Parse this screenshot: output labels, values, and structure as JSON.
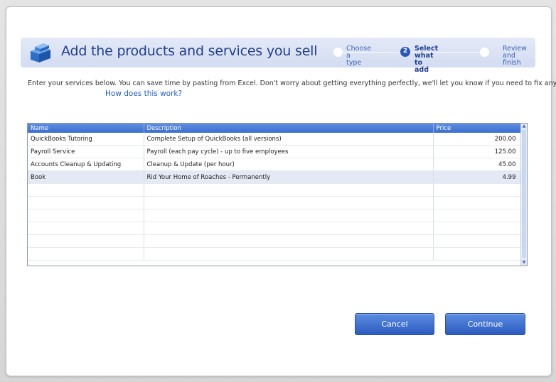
{
  "header": {
    "title": "Add the products and services you sell",
    "icon": "stacked-boxes-icon"
  },
  "steps": [
    {
      "label": "Choose a\ntype",
      "number": "",
      "active": false
    },
    {
      "label": "Select what\nto add",
      "number": "2",
      "active": true
    },
    {
      "label": "Review and\nfinish",
      "number": "",
      "active": false
    }
  ],
  "intro": {
    "text": "Enter your services below.  You can save time by pasting from Excel. Don't worry about getting everything perfectly, we'll let you know if you need to fix anything.",
    "help_link": "How does this work?"
  },
  "grid": {
    "columns": [
      "Name",
      "Description",
      "Price"
    ],
    "rows": [
      {
        "name": "QuickBooks Tutoring",
        "description": "Complete Setup of QuickBooks (all versions)",
        "price": "200.00"
      },
      {
        "name": "Payroll Service",
        "description": "Payroll  (each pay cycle) - up to five employees",
        "price": "125.00"
      },
      {
        "name": "Accounts Cleanup & Updating",
        "description": "Cleanup & Update (per hour)",
        "price": "45.00"
      },
      {
        "name": "Book",
        "description": "Rid Your Home of Roaches - Permanently",
        "price": "4.99"
      },
      {
        "name": "",
        "description": "",
        "price": ""
      },
      {
        "name": "",
        "description": "",
        "price": ""
      },
      {
        "name": "",
        "description": "",
        "price": ""
      },
      {
        "name": "",
        "description": "",
        "price": ""
      },
      {
        "name": "",
        "description": "",
        "price": ""
      },
      {
        "name": "",
        "description": "",
        "price": ""
      }
    ],
    "selected_row": 3
  },
  "buttons": {
    "cancel": "Cancel",
    "continue": "Continue"
  },
  "colors": {
    "accent": "#2c5bbf",
    "header_band": "#d9e1f4",
    "title_text": "#1f3f92"
  }
}
